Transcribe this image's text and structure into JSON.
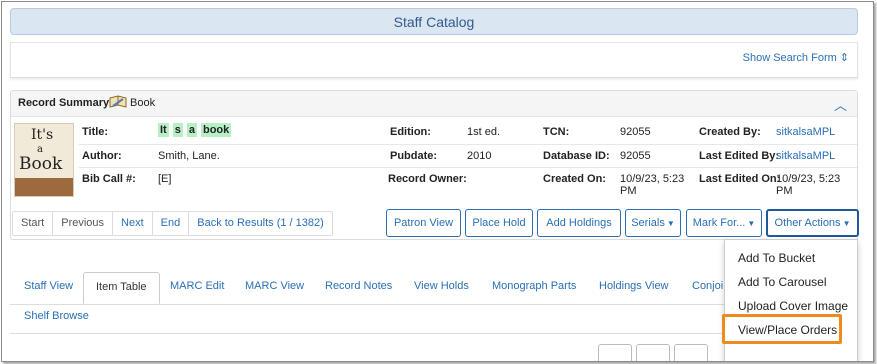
{
  "header": {
    "title": "Staff Catalog"
  },
  "search": {
    "toggle_label": "Show Search Form",
    "toggle_icon": "chevron-up-down-icon"
  },
  "record": {
    "heading": "Record Summary",
    "format": "Book",
    "format_icon": "book-icon",
    "collapse_icon": "chevron-up-icon",
    "cover": {
      "line1": "It's",
      "line2": "a",
      "line3": "Book"
    },
    "title_label": "Title:",
    "title_words": [
      "It",
      "s",
      "a",
      "book"
    ],
    "author_label": "Author:",
    "author": "Smith, Lane.",
    "bib_call_label": "Bib Call #:",
    "bib_call": "[E]",
    "edition_label": "Edition:",
    "edition": "1st ed.",
    "pubdate_label": "Pubdate:",
    "pubdate": "2010",
    "owner_label": "Record Owner:",
    "owner": "",
    "tcn_label": "TCN:",
    "tcn": "92055",
    "dbid_label": "Database ID:",
    "dbid": "92055",
    "created_on_label": "Created On:",
    "created_on_1": "10/9/23, 5:23",
    "created_on_2": "PM",
    "created_by_label": "Created By:",
    "created_by": "sitkalsaMPL",
    "edited_by_label": "Last Edited By:",
    "edited_by": "sitkalsaMPL",
    "edited_on_label": "Last Edited On:",
    "edited_on_1": "10/9/23, 5:23",
    "edited_on_2": "PM"
  },
  "pager": {
    "start": "Start",
    "previous": "Previous",
    "next": "Next",
    "end": "End",
    "back": "Back to Results (1 / 1382)"
  },
  "actions": {
    "patron_view": "Patron View",
    "place_hold": "Place Hold",
    "add_holdings": "Add Holdings",
    "serials": "Serials",
    "mark_for": "Mark For...",
    "other_actions": "Other Actions"
  },
  "menu": {
    "items": [
      "Add To Bucket",
      "Add To Carousel",
      "Upload Cover Image",
      "View/Place Orders"
    ],
    "highlight_color": "#ef8a1d"
  },
  "tabs": {
    "items": [
      "Staff View",
      "Item Table",
      "MARC Edit",
      "MARC View",
      "Record Notes",
      "View Holds",
      "Monograph Parts",
      "Holdings View",
      "Conjoi"
    ],
    "active": "Item Table",
    "second_row": "Shelf Browse"
  },
  "colors": {
    "link": "#2a6fb5",
    "banner_bg": "#dbe6f3",
    "highlight_title": "#b8f0c6"
  }
}
